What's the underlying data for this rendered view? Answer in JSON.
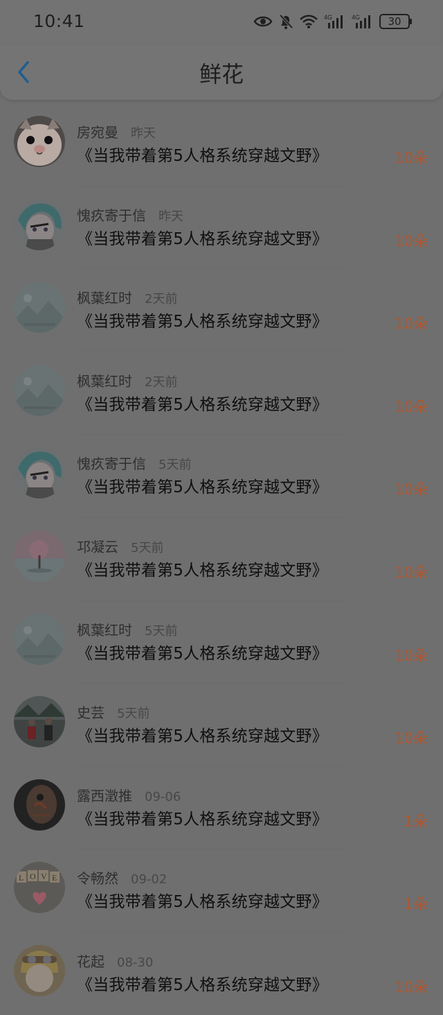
{
  "status_bar": {
    "time": "10:41",
    "battery": "30",
    "icons": [
      "eye-icon",
      "mute-icon",
      "wifi-icon",
      "signal-4g-icon",
      "signal-4g-icon",
      "battery-icon"
    ]
  },
  "header": {
    "title": "鲜花",
    "back_icon": "chevron-left-icon",
    "accent_color": "#1f7fd3"
  },
  "items": [
    {
      "name": "房宛曼",
      "time": "昨天",
      "book": "《当我带着第5人格系统穿越文野》",
      "count": "10朵",
      "avatar": "cat-avatar"
    },
    {
      "name": "愧疚寄于信",
      "time": "昨天",
      "book": "《当我带着第5人格系统穿越文野》",
      "count": "10朵",
      "avatar": "anime-avatar"
    },
    {
      "name": "枫葉红时",
      "time": "2天前",
      "book": "《当我带着第5人格系统穿越文野》",
      "count": "10朵",
      "avatar": "placeholder-avatar"
    },
    {
      "name": "枫葉红时",
      "time": "2天前",
      "book": "《当我带着第5人格系统穿越文野》",
      "count": "10朵",
      "avatar": "placeholder-avatar"
    },
    {
      "name": "愧疚寄于信",
      "time": "5天前",
      "book": "《当我带着第5人格系统穿越文野》",
      "count": "10朵",
      "avatar": "anime-avatar"
    },
    {
      "name": "邛凝云",
      "time": "5天前",
      "book": "《当我带着第5人格系统穿越文野》",
      "count": "10朵",
      "avatar": "tree-avatar"
    },
    {
      "name": "枫葉红时",
      "time": "5天前",
      "book": "《当我带着第5人格系统穿越文野》",
      "count": "10朵",
      "avatar": "placeholder-avatar"
    },
    {
      "name": "史芸",
      "time": "5天前",
      "book": "《当我带着第5人格系统穿越文野》",
      "count": "10朵",
      "avatar": "photo-avatar"
    },
    {
      "name": "露西澂推",
      "time": "09-06",
      "book": "《当我带着第5人格系统穿越文野》",
      "count": "1朵",
      "avatar": "dark-avatar"
    },
    {
      "name": "令畅然",
      "time": "09-02",
      "book": "《当我带着第5人格系统穿越文野》",
      "count": "1朵",
      "avatar": "love-avatar"
    },
    {
      "name": "花起",
      "time": "08-30",
      "book": "《当我带着第5人格系统穿越文野》",
      "count": "10朵",
      "avatar": "girl-avatar"
    }
  ]
}
